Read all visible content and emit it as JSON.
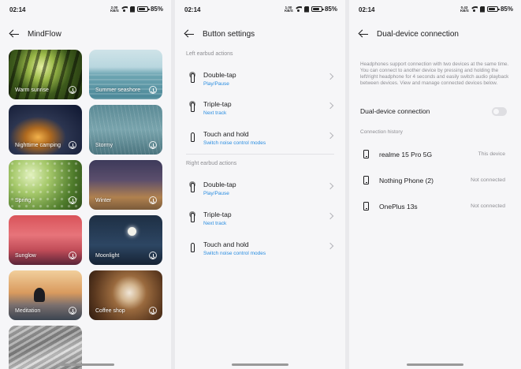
{
  "statusbars": [
    {
      "time": "02:14",
      "net_top": "2.00",
      "net_bottom": "KB/S",
      "battery": "85%"
    },
    {
      "time": "02:14",
      "net_top": "1.00",
      "net_bottom": "KB/S",
      "battery": "85%"
    },
    {
      "time": "02:14",
      "net_top": "0.43",
      "net_bottom": "KB/S",
      "battery": "85%"
    }
  ],
  "mindflow": {
    "title": "MindFlow",
    "tiles": [
      {
        "label": "Warm sunrise"
      },
      {
        "label": "Summer seashore"
      },
      {
        "label": "Nighttime camping"
      },
      {
        "label": "Stormy"
      },
      {
        "label": "Spring"
      },
      {
        "label": "Winter"
      },
      {
        "label": "Sunglow"
      },
      {
        "label": "Moonlight"
      },
      {
        "label": "Meditation"
      },
      {
        "label": "Coffee shop"
      },
      {
        "label": ""
      }
    ]
  },
  "button_settings": {
    "title": "Button settings",
    "left_header": "Left earbud actions",
    "right_header": "Right earbud actions",
    "left": [
      {
        "name": "Double-tap",
        "value": "Play/Pause"
      },
      {
        "name": "Triple-tap",
        "value": "Next track"
      },
      {
        "name": "Touch and hold",
        "value": "Switch noise control modes"
      }
    ],
    "right": [
      {
        "name": "Double-tap",
        "value": "Play/Pause"
      },
      {
        "name": "Triple-tap",
        "value": "Next track"
      },
      {
        "name": "Touch and hold",
        "value": "Switch noise control modes"
      }
    ]
  },
  "dual_device": {
    "title": "Dual-device connection",
    "description": "Headphones support connection with two devices at the same time. You can connect to another device by pressing and holding the left/right headphone for 4 seconds and easily switch audio playback between devices. View and manage connected devices below.",
    "toggle_label": "Dual-device connection",
    "toggle_on": false,
    "history_header": "Connection history",
    "devices": [
      {
        "name": "realme 15 Pro 5G",
        "status": "This device"
      },
      {
        "name": "Nothing Phone (2)",
        "status": "Not connected"
      },
      {
        "name": "OnePlus 13s",
        "status": "Not connected"
      }
    ]
  }
}
